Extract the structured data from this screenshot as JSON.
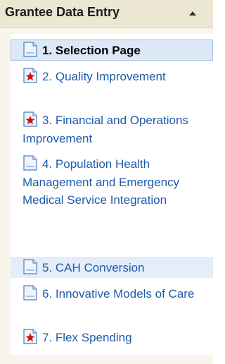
{
  "panel": {
    "title": "Grantee Data Entry"
  },
  "items": [
    {
      "label": "1. Selection Page",
      "icon": "document-icon",
      "state": "selected"
    },
    {
      "label": "2. Quality Improvement",
      "icon": "starred-document-icon",
      "state": "normal"
    },
    {
      "label": "3. Financial and Operations Improvement",
      "icon": "starred-document-icon",
      "state": "normal"
    },
    {
      "label": "4. Population Health Management and Emergency Medical Service Integration",
      "icon": "document-icon",
      "state": "normal"
    },
    {
      "label": "5. CAH Conversion",
      "icon": "document-icon",
      "state": "hover"
    },
    {
      "label": "6. Innovative Models of Care",
      "icon": "document-icon",
      "state": "normal"
    },
    {
      "label": "7. Flex Spending",
      "icon": "starred-document-icon",
      "state": "normal"
    }
  ],
  "colors": {
    "link": "#1d5bab",
    "header_bg": "#ece7d3",
    "selected_bg": "#dde8f7",
    "star": "#cc1111"
  }
}
